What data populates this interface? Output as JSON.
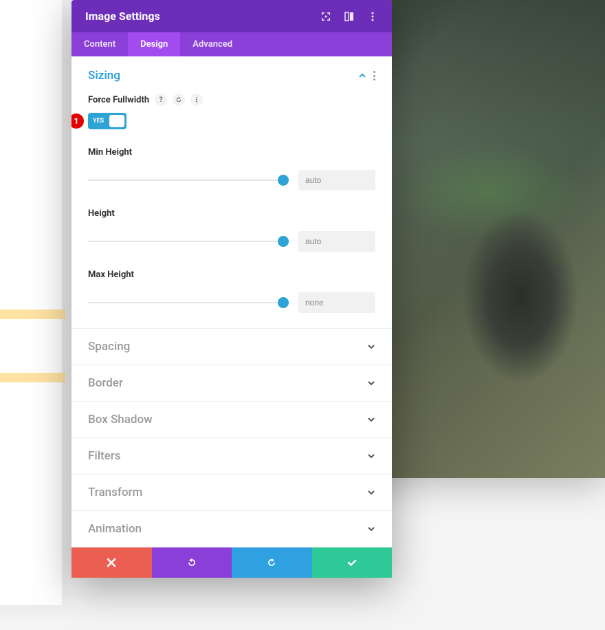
{
  "modal": {
    "title": "Image Settings"
  },
  "tabs": {
    "content": "Content",
    "design": "Design",
    "advanced": "Advanced"
  },
  "sizing": {
    "title": "Sizing",
    "force_fullwidth_label": "Force Fullwidth",
    "toggle_state": "YES",
    "min_height": {
      "label": "Min Height",
      "value": "auto"
    },
    "height": {
      "label": "Height",
      "value": "auto"
    },
    "max_height": {
      "label": "Max Height",
      "value": "none"
    }
  },
  "sections": {
    "spacing": "Spacing",
    "border": "Border",
    "box_shadow": "Box Shadow",
    "filters": "Filters",
    "transform": "Transform",
    "animation": "Animation"
  },
  "callout": "1"
}
